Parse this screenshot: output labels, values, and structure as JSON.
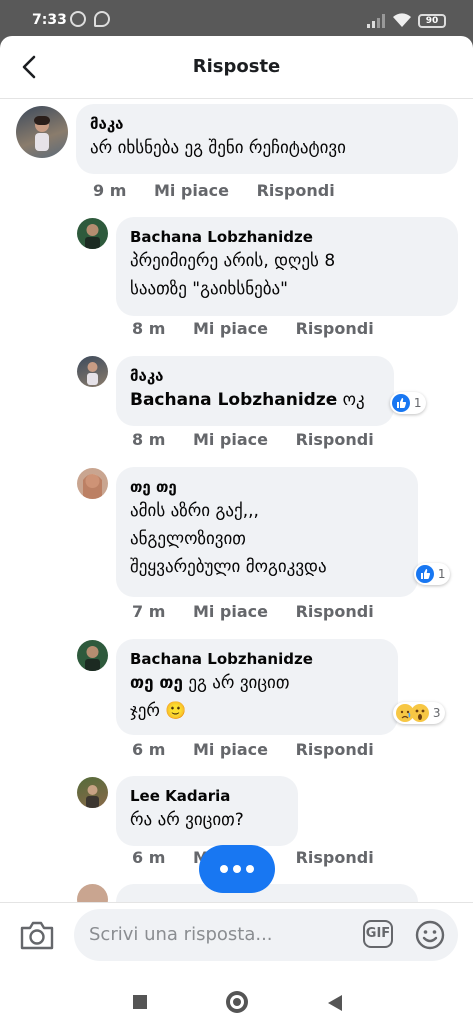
{
  "status_bar": {
    "time": "7:33",
    "battery": "90"
  },
  "header": {
    "title": "Risposte"
  },
  "comments": [
    {
      "name": "მაკა",
      "text_lines": [
        "არ იხსნება ეგ შენი რეჩიტატივი"
      ],
      "time": "9 m"
    },
    {
      "name": "Bachana Lobzhanidze",
      "text_lines": [
        "პრეიმიერე არის, დღეს 8",
        "საათზე \"გაიხსნება\""
      ],
      "time": "8 m"
    },
    {
      "name": "მაკა",
      "mention": "Bachana Lobzhanidze",
      "text_lines": [
        "ოკ"
      ],
      "time": "8 m",
      "reaction_count": "1"
    },
    {
      "name": "თე თე",
      "text_lines": [
        "ამის აზრი გაქ,,,",
        "ანგელოზივით",
        "შეყვარებული მოგიკვდა"
      ],
      "time": "7 m",
      "reaction_count": "1"
    },
    {
      "name": "Bachana Lobzhanidze",
      "mention": "თე თე",
      "text_lines": [
        "ეგ არ ვიცით",
        "ჯერ 🙂"
      ],
      "time": "6 m",
      "reaction_count": "3"
    },
    {
      "name": "Lee Kadaria",
      "text_lines": [
        "რა არ ვიცით?"
      ],
      "time": "6 m"
    }
  ],
  "actions": {
    "like": "Mi piace",
    "reply": "Rispondi"
  },
  "composer": {
    "placeholder": "Scrivi una risposta...",
    "gif": "GIF"
  },
  "icons": [
    "back-arrow-icon",
    "camera-icon",
    "gif-icon",
    "emoji-icon",
    "more-dots-icon",
    "like-icon",
    "sad-emoji-icon",
    "wow-emoji-icon",
    "recent-apps-icon",
    "home-icon",
    "back-nav-icon"
  ],
  "colors": {
    "accent": "#1877f2",
    "bubble": "#f0f2f5",
    "meta": "#65676b"
  }
}
